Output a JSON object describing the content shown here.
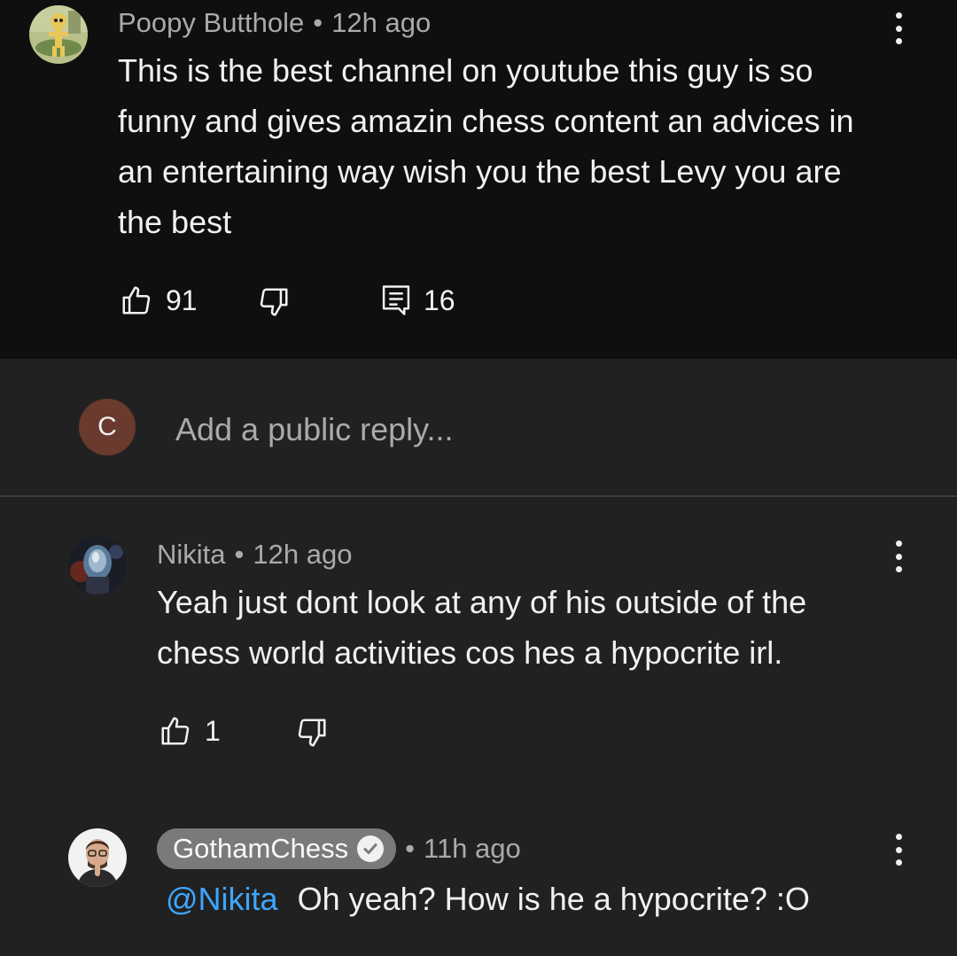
{
  "parent_comment": {
    "author": "Poopy Butthole",
    "time": "12h ago",
    "text_lines": [
      "This is the best channel on youtube this guy is so",
      "funny and gives amazin chess content an advices in",
      "an entertaining way wish you the best Levy you are",
      "the best"
    ],
    "likes": "91",
    "replies": "16",
    "avatar_icon": "cartoon-character-avatar"
  },
  "composer": {
    "avatar_letter": "C",
    "avatar_color": "#6a3a2e",
    "placeholder": "Add a public reply..."
  },
  "replies": [
    {
      "author": "Nikita",
      "time": "12h ago",
      "text_lines": [
        "Yeah just dont look at any of his outside of the",
        "chess world activities cos hes a hypocrite irl."
      ],
      "likes": "1"
    },
    {
      "author": "GothamChess",
      "verified": true,
      "time": "11h ago",
      "mention": "@Nikita",
      "text": "Oh yeah? How is he a hypocrite? :O"
    }
  ],
  "separator": "•",
  "colors": {
    "background": "#212121",
    "parent_background": "#0f0f0f",
    "mention": "#3ea6ff",
    "meta_text": "#aaaaaa"
  }
}
